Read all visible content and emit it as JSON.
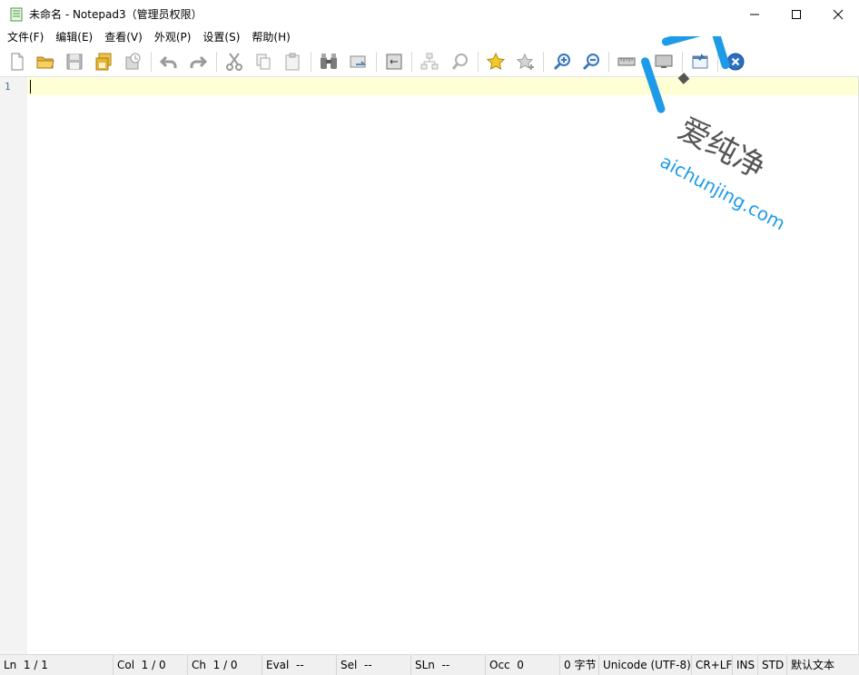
{
  "window": {
    "title": "未命名 - Notepad3（管理员权限）",
    "icon": "notepad-icon"
  },
  "menu": [
    {
      "label": "文件(F)"
    },
    {
      "label": "编辑(E)"
    },
    {
      "label": "查看(V)"
    },
    {
      "label": "外观(P)"
    },
    {
      "label": "设置(S)"
    },
    {
      "label": "帮助(H)"
    }
  ],
  "toolbar": [
    {
      "icon": "new-file-icon"
    },
    {
      "icon": "open-folder-icon"
    },
    {
      "icon": "save-icon"
    },
    {
      "icon": "save-as-icon"
    },
    {
      "icon": "save-copy-icon"
    },
    {
      "icon": "undo-icon"
    },
    {
      "icon": "redo-icon"
    },
    {
      "icon": "cut-icon"
    },
    {
      "icon": "copy-icon"
    },
    {
      "icon": "paste-icon"
    },
    {
      "icon": "find-icon"
    },
    {
      "icon": "replace-icon"
    },
    {
      "icon": "word-wrap-icon"
    },
    {
      "icon": "tree-icon"
    },
    {
      "icon": "zoom-fit-icon"
    },
    {
      "icon": "star-icon"
    },
    {
      "icon": "star-add-icon"
    },
    {
      "icon": "zoom-in-icon"
    },
    {
      "icon": "zoom-out-icon"
    },
    {
      "icon": "ruler-icon"
    },
    {
      "icon": "monitor-icon"
    },
    {
      "icon": "pin-window-icon"
    },
    {
      "icon": "exit-icon"
    }
  ],
  "editor": {
    "line_numbers": [
      "1"
    ],
    "current_line_color": "#ffffd6"
  },
  "status": {
    "ln": "Ln  1 / 1",
    "col": "Col  1 / 0",
    "ch": "Ch  1 / 0",
    "eval": "Eval  --",
    "sel": "Sel  --",
    "sln": "SLn  --",
    "occ": "Occ  0",
    "bytes": "0 字节",
    "encoding": "Unicode (UTF-8)",
    "eol": "CR+LF",
    "ins": "INS",
    "std": "STD",
    "lexer": "默认文本"
  },
  "watermark": {
    "brand_cn": "爱纯净",
    "brand_url": "aichunjing.com",
    "color": "#1e9be8"
  }
}
